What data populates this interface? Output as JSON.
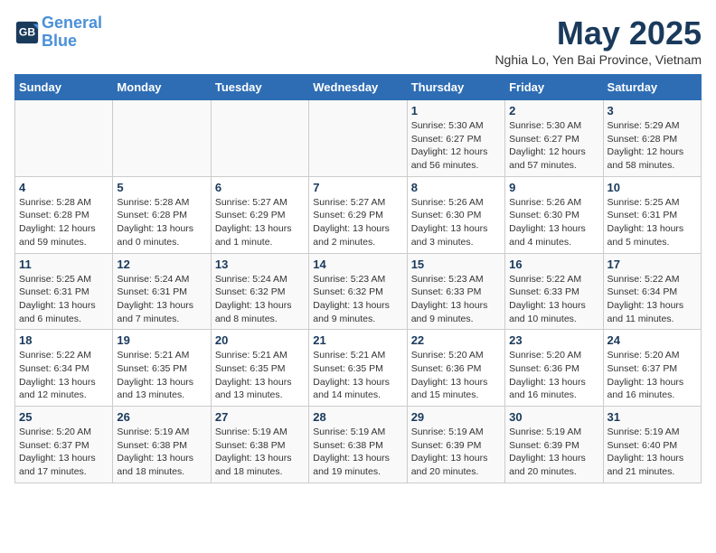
{
  "header": {
    "logo_line1": "General",
    "logo_line2": "Blue",
    "month": "May 2025",
    "location": "Nghia Lo, Yen Bai Province, Vietnam"
  },
  "weekdays": [
    "Sunday",
    "Monday",
    "Tuesday",
    "Wednesday",
    "Thursday",
    "Friday",
    "Saturday"
  ],
  "weeks": [
    [
      {
        "day": "",
        "info": ""
      },
      {
        "day": "",
        "info": ""
      },
      {
        "day": "",
        "info": ""
      },
      {
        "day": "",
        "info": ""
      },
      {
        "day": "1",
        "info": "Sunrise: 5:30 AM\nSunset: 6:27 PM\nDaylight: 12 hours\nand 56 minutes."
      },
      {
        "day": "2",
        "info": "Sunrise: 5:30 AM\nSunset: 6:27 PM\nDaylight: 12 hours\nand 57 minutes."
      },
      {
        "day": "3",
        "info": "Sunrise: 5:29 AM\nSunset: 6:28 PM\nDaylight: 12 hours\nand 58 minutes."
      }
    ],
    [
      {
        "day": "4",
        "info": "Sunrise: 5:28 AM\nSunset: 6:28 PM\nDaylight: 12 hours\nand 59 minutes."
      },
      {
        "day": "5",
        "info": "Sunrise: 5:28 AM\nSunset: 6:28 PM\nDaylight: 13 hours\nand 0 minutes."
      },
      {
        "day": "6",
        "info": "Sunrise: 5:27 AM\nSunset: 6:29 PM\nDaylight: 13 hours\nand 1 minute."
      },
      {
        "day": "7",
        "info": "Sunrise: 5:27 AM\nSunset: 6:29 PM\nDaylight: 13 hours\nand 2 minutes."
      },
      {
        "day": "8",
        "info": "Sunrise: 5:26 AM\nSunset: 6:30 PM\nDaylight: 13 hours\nand 3 minutes."
      },
      {
        "day": "9",
        "info": "Sunrise: 5:26 AM\nSunset: 6:30 PM\nDaylight: 13 hours\nand 4 minutes."
      },
      {
        "day": "10",
        "info": "Sunrise: 5:25 AM\nSunset: 6:31 PM\nDaylight: 13 hours\nand 5 minutes."
      }
    ],
    [
      {
        "day": "11",
        "info": "Sunrise: 5:25 AM\nSunset: 6:31 PM\nDaylight: 13 hours\nand 6 minutes."
      },
      {
        "day": "12",
        "info": "Sunrise: 5:24 AM\nSunset: 6:31 PM\nDaylight: 13 hours\nand 7 minutes."
      },
      {
        "day": "13",
        "info": "Sunrise: 5:24 AM\nSunset: 6:32 PM\nDaylight: 13 hours\nand 8 minutes."
      },
      {
        "day": "14",
        "info": "Sunrise: 5:23 AM\nSunset: 6:32 PM\nDaylight: 13 hours\nand 9 minutes."
      },
      {
        "day": "15",
        "info": "Sunrise: 5:23 AM\nSunset: 6:33 PM\nDaylight: 13 hours\nand 9 minutes."
      },
      {
        "day": "16",
        "info": "Sunrise: 5:22 AM\nSunset: 6:33 PM\nDaylight: 13 hours\nand 10 minutes."
      },
      {
        "day": "17",
        "info": "Sunrise: 5:22 AM\nSunset: 6:34 PM\nDaylight: 13 hours\nand 11 minutes."
      }
    ],
    [
      {
        "day": "18",
        "info": "Sunrise: 5:22 AM\nSunset: 6:34 PM\nDaylight: 13 hours\nand 12 minutes."
      },
      {
        "day": "19",
        "info": "Sunrise: 5:21 AM\nSunset: 6:35 PM\nDaylight: 13 hours\nand 13 minutes."
      },
      {
        "day": "20",
        "info": "Sunrise: 5:21 AM\nSunset: 6:35 PM\nDaylight: 13 hours\nand 13 minutes."
      },
      {
        "day": "21",
        "info": "Sunrise: 5:21 AM\nSunset: 6:35 PM\nDaylight: 13 hours\nand 14 minutes."
      },
      {
        "day": "22",
        "info": "Sunrise: 5:20 AM\nSunset: 6:36 PM\nDaylight: 13 hours\nand 15 minutes."
      },
      {
        "day": "23",
        "info": "Sunrise: 5:20 AM\nSunset: 6:36 PM\nDaylight: 13 hours\nand 16 minutes."
      },
      {
        "day": "24",
        "info": "Sunrise: 5:20 AM\nSunset: 6:37 PM\nDaylight: 13 hours\nand 16 minutes."
      }
    ],
    [
      {
        "day": "25",
        "info": "Sunrise: 5:20 AM\nSunset: 6:37 PM\nDaylight: 13 hours\nand 17 minutes."
      },
      {
        "day": "26",
        "info": "Sunrise: 5:19 AM\nSunset: 6:38 PM\nDaylight: 13 hours\nand 18 minutes."
      },
      {
        "day": "27",
        "info": "Sunrise: 5:19 AM\nSunset: 6:38 PM\nDaylight: 13 hours\nand 18 minutes."
      },
      {
        "day": "28",
        "info": "Sunrise: 5:19 AM\nSunset: 6:38 PM\nDaylight: 13 hours\nand 19 minutes."
      },
      {
        "day": "29",
        "info": "Sunrise: 5:19 AM\nSunset: 6:39 PM\nDaylight: 13 hours\nand 20 minutes."
      },
      {
        "day": "30",
        "info": "Sunrise: 5:19 AM\nSunset: 6:39 PM\nDaylight: 13 hours\nand 20 minutes."
      },
      {
        "day": "31",
        "info": "Sunrise: 5:19 AM\nSunset: 6:40 PM\nDaylight: 13 hours\nand 21 minutes."
      }
    ]
  ]
}
